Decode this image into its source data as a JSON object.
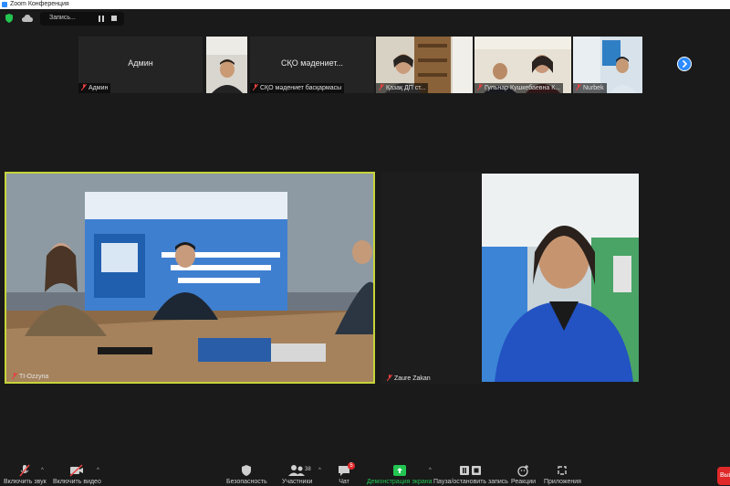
{
  "window": {
    "title": "Zoom Конференция"
  },
  "recording": {
    "label": "Запись..."
  },
  "thumbnails": [
    {
      "display_name": "Админ",
      "caption": "Админ"
    },
    {
      "display_name": "",
      "caption": ""
    },
    {
      "display_name": "СҚО мәдениет...",
      "caption": "СҚО мәдениет басқармасы"
    },
    {
      "display_name": "",
      "caption": "Қазақ ДП ст..."
    },
    {
      "display_name": "",
      "caption": "Гульнар Кушкебаевна К..."
    },
    {
      "display_name": "",
      "caption": "Nurbek"
    }
  ],
  "tiles": [
    {
      "name": "TI-Ozzyna"
    },
    {
      "name": "Zaure Zakan"
    },
    {
      "name": ""
    }
  ],
  "toolbar": {
    "audio": "Включить звук",
    "video": "Включить видео",
    "security": "Безопасность",
    "participants": "Участники",
    "participants_count": "38",
    "chat": "Чат",
    "chat_badge": "5",
    "share": "Демонстрация экрана",
    "record": "Пауза/остановить запись",
    "reactions": "Реакции",
    "apps": "Приложения",
    "end": "Выйти"
  },
  "colors": {
    "accent": "#2d8cff",
    "share_green": "#23c552",
    "speaker_border": "#c6d43a",
    "end_red": "#e02828"
  }
}
